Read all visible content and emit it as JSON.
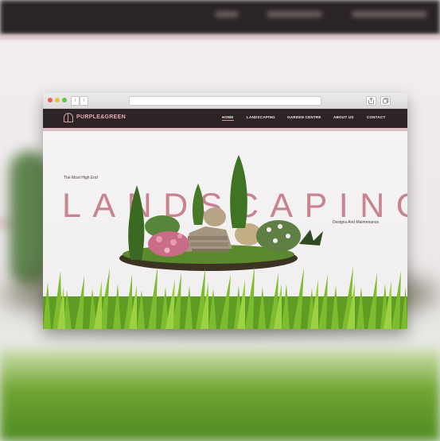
{
  "browser": {
    "back_icon": "‹",
    "forward_icon": "›",
    "share_icon": "share-icon",
    "tabs_icon": "tabs-icon"
  },
  "site": {
    "logo": "PURPLE&GREEN",
    "menu": [
      "HOME",
      "LANDSCAPING",
      "GARDEN CENTRE",
      "ABOUT US",
      "CONTACT"
    ],
    "active_menu": "HOME",
    "accent_color": "#c7838f",
    "nav_color": "#2c2425"
  },
  "hero": {
    "tagline": "The Most High End",
    "headline": "LANDSCAPING",
    "subline": "Designs And Maintenance"
  }
}
